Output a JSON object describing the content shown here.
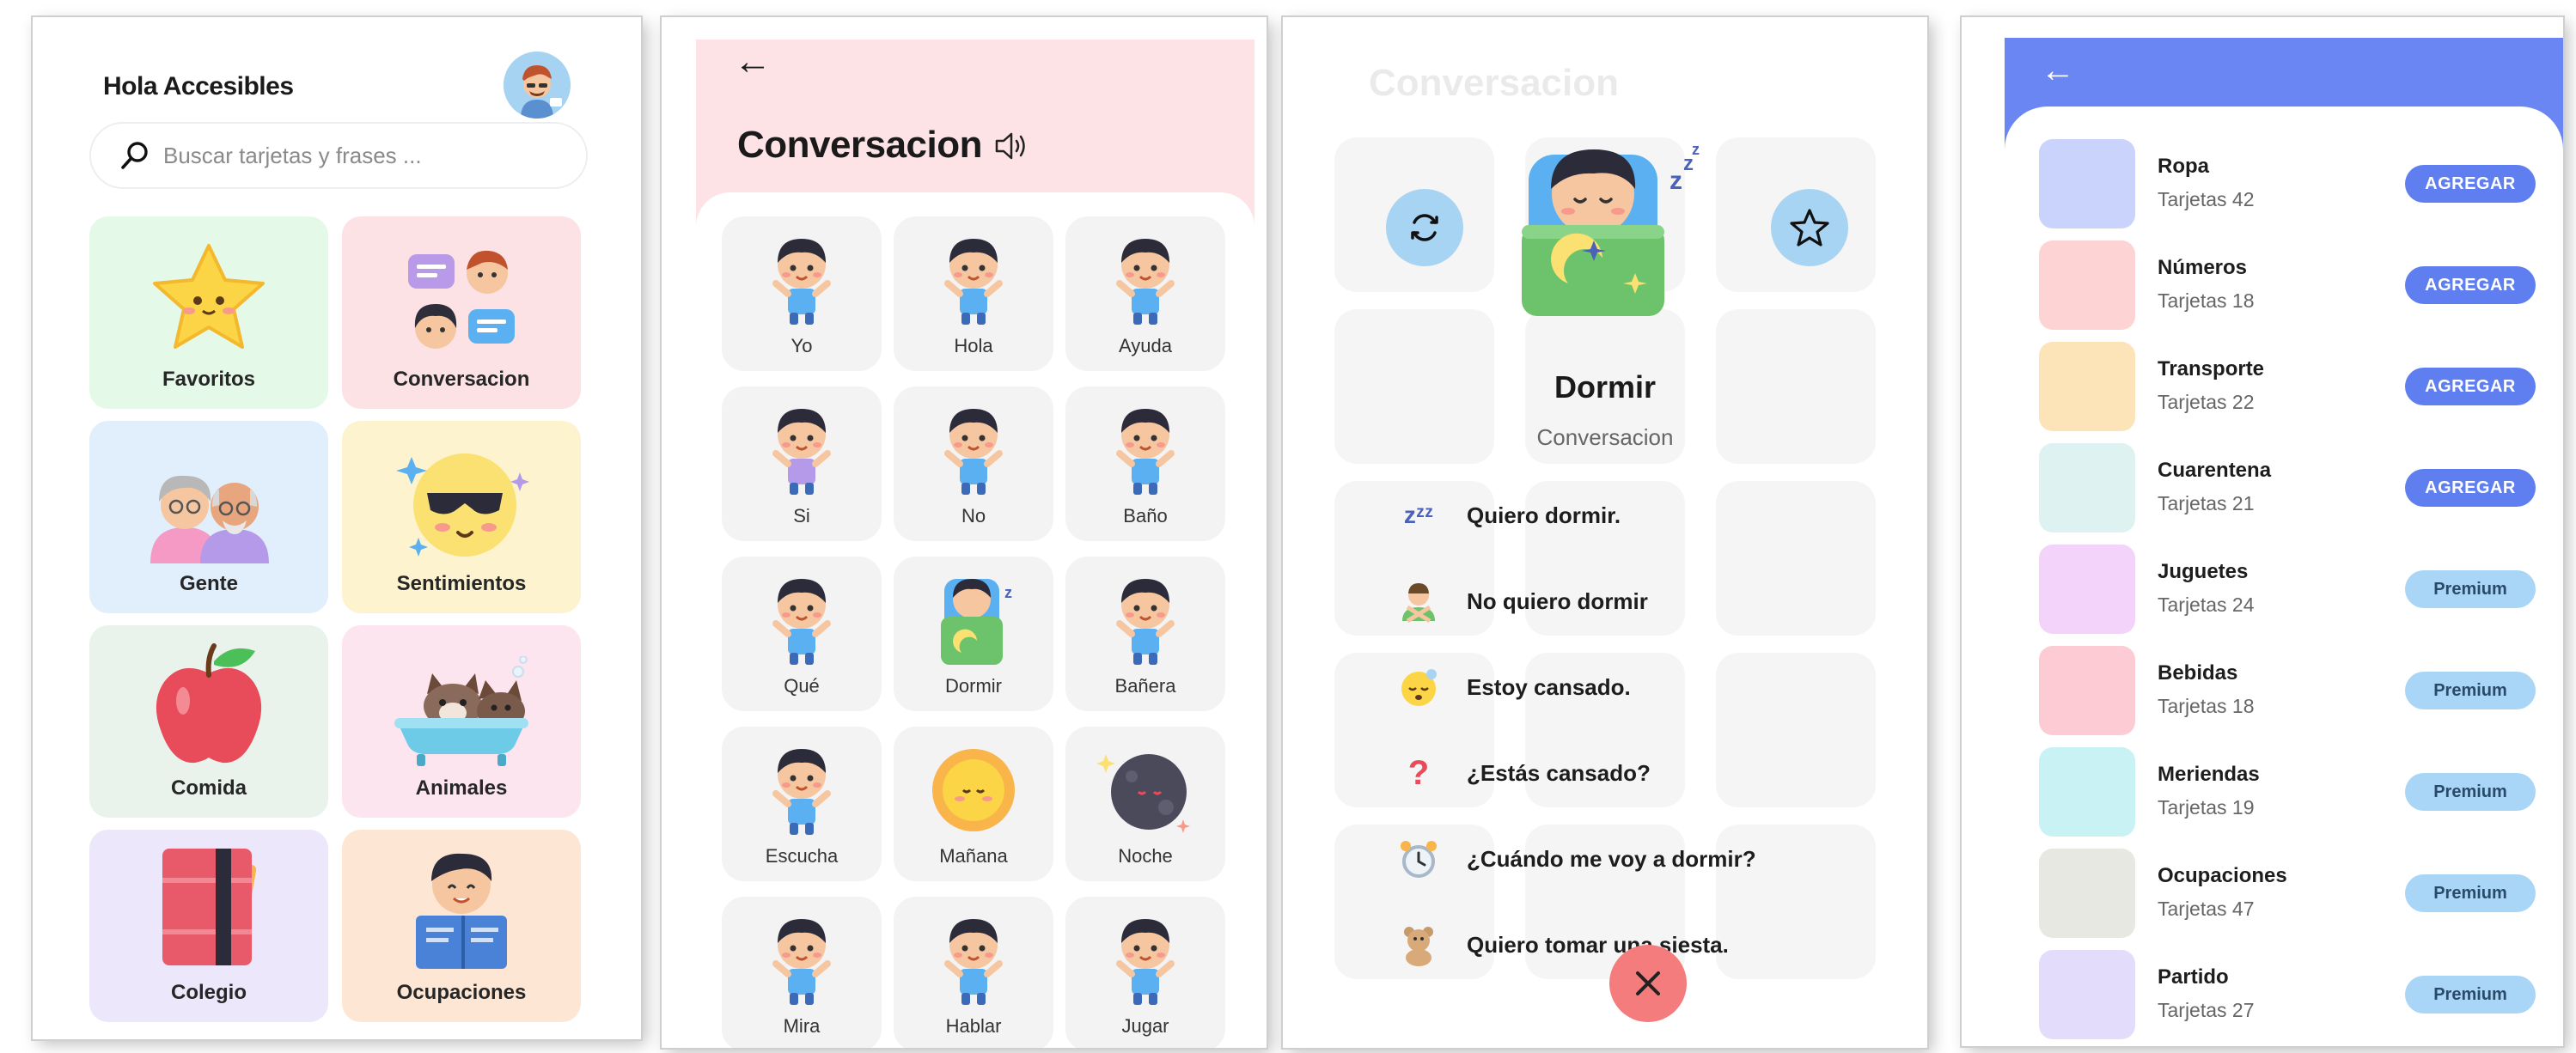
{
  "home": {
    "greeting": "Hola Accesibles",
    "search_placeholder": "Buscar tarjetas y frases ...",
    "categories": [
      {
        "label": "Favoritos",
        "color": "#e4f9e7"
      },
      {
        "label": "Conversacion",
        "color": "#fde2e5"
      },
      {
        "label": "Gente",
        "color": "#e1eefb"
      },
      {
        "label": "Sentimientos",
        "color": "#fdf4cf"
      },
      {
        "label": "Comida",
        "color": "#e9f3ec"
      },
      {
        "label": "Animales",
        "color": "#fde5f0"
      },
      {
        "label": "Colegio",
        "color": "#ece7fb"
      },
      {
        "label": "Ocupaciones",
        "color": "#fde7d4"
      }
    ]
  },
  "conversation": {
    "back": "←",
    "title": "Conversacion",
    "header_color": "#fde3e6",
    "tiles": [
      {
        "label": "Yo"
      },
      {
        "label": "Hola"
      },
      {
        "label": "Ayuda"
      },
      {
        "label": "Si"
      },
      {
        "label": "No"
      },
      {
        "label": "Baño"
      },
      {
        "label": "Qué"
      },
      {
        "label": "Dormir"
      },
      {
        "label": "Bañera"
      },
      {
        "label": "Escucha"
      },
      {
        "label": "Mañana"
      },
      {
        "label": "Noche"
      },
      {
        "label": "Mira"
      },
      {
        "label": "Hablar"
      },
      {
        "label": "Jugar"
      }
    ]
  },
  "detail": {
    "background_title": "Conversacion",
    "word": "Dormir",
    "category": "Conversacion",
    "phrases": [
      {
        "text": "Quiero dormir.",
        "icon": "zzz-icon"
      },
      {
        "text": "No quiero dormir",
        "icon": "person-gesturing-no-icon"
      },
      {
        "text": "Estoy cansado.",
        "icon": "sleepy-face-icon"
      },
      {
        "text": "¿Estás cansado?",
        "icon": "question-mark-icon"
      },
      {
        "text": "¿Cuándo me voy a dormir?",
        "icon": "alarm-clock-icon"
      },
      {
        "text": "Quiero tomar una siesta.",
        "icon": "teddy-bear-icon"
      }
    ]
  },
  "packs": {
    "back": "←",
    "header_color": "#6a86f2",
    "items": [
      {
        "name": "Ropa",
        "count": "Tarjetas 42",
        "button": "AGREGAR",
        "type": "agregar",
        "color": "#c9d3fb"
      },
      {
        "name": "Números",
        "count": "Tarjetas 18",
        "button": "AGREGAR",
        "type": "agregar",
        "color": "#fdd3d4"
      },
      {
        "name": "Transporte",
        "count": "Tarjetas 22",
        "button": "AGREGAR",
        "type": "agregar",
        "color": "#fde3b8"
      },
      {
        "name": "Cuarentena",
        "count": "Tarjetas 21",
        "button": "AGREGAR",
        "type": "agregar",
        "color": "#def2f2"
      },
      {
        "name": "Juguetes",
        "count": "Tarjetas 24",
        "button": "Premium",
        "type": "premium",
        "color": "#f4d3fb"
      },
      {
        "name": "Bebidas",
        "count": "Tarjetas 18",
        "button": "Premium",
        "type": "premium",
        "color": "#fccbd4"
      },
      {
        "name": "Meriendas",
        "count": "Tarjetas 19",
        "button": "Premium",
        "type": "premium",
        "color": "#c9f2f4"
      },
      {
        "name": "Ocupaciones",
        "count": "Tarjetas 47",
        "button": "Premium",
        "type": "premium",
        "color": "#e8e8e2"
      },
      {
        "name": "Partido",
        "count": "Tarjetas 27",
        "button": "Premium",
        "type": "premium",
        "color": "#e4dcfb"
      }
    ]
  }
}
